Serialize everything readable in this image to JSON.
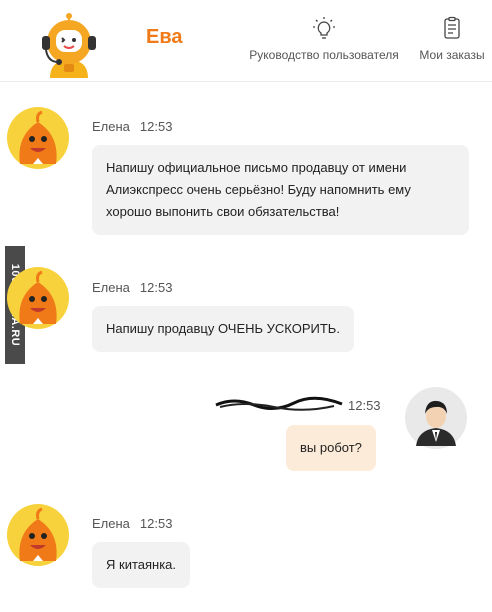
{
  "header": {
    "bot_name": "Ева",
    "guide_label": "Руководство пользователя",
    "orders_label": "Мои заказы",
    "icons": {
      "bot": "robot-mascot-icon",
      "guide": "lightbulb-icon",
      "orders": "clipboard-list-icon"
    }
  },
  "watermark": "1001MEMA.RU",
  "messages": [
    {
      "sender": "Елена",
      "time": "12:53",
      "text_lines": [
        "Напишу официальное письмо продавцу от имени",
        "Алиэкспресс очень серьёзно! Буду напомнить ему",
        "хорошо выпонить свои обязательства!"
      ]
    },
    {
      "sender": "Елена",
      "time": "12:53",
      "text": "Напишу продавцу ОЧЕНЬ УСКОРИТЬ."
    },
    {
      "sender": "",
      "time": "12:53",
      "text": "вы робот?",
      "own": true
    },
    {
      "sender": "Елена",
      "time": "12:53",
      "text": "Я китаянка."
    }
  ],
  "colors": {
    "accent": "#f07a18",
    "agent_bubble": "#f2f2f2",
    "own_bubble": "#fdebd9"
  }
}
